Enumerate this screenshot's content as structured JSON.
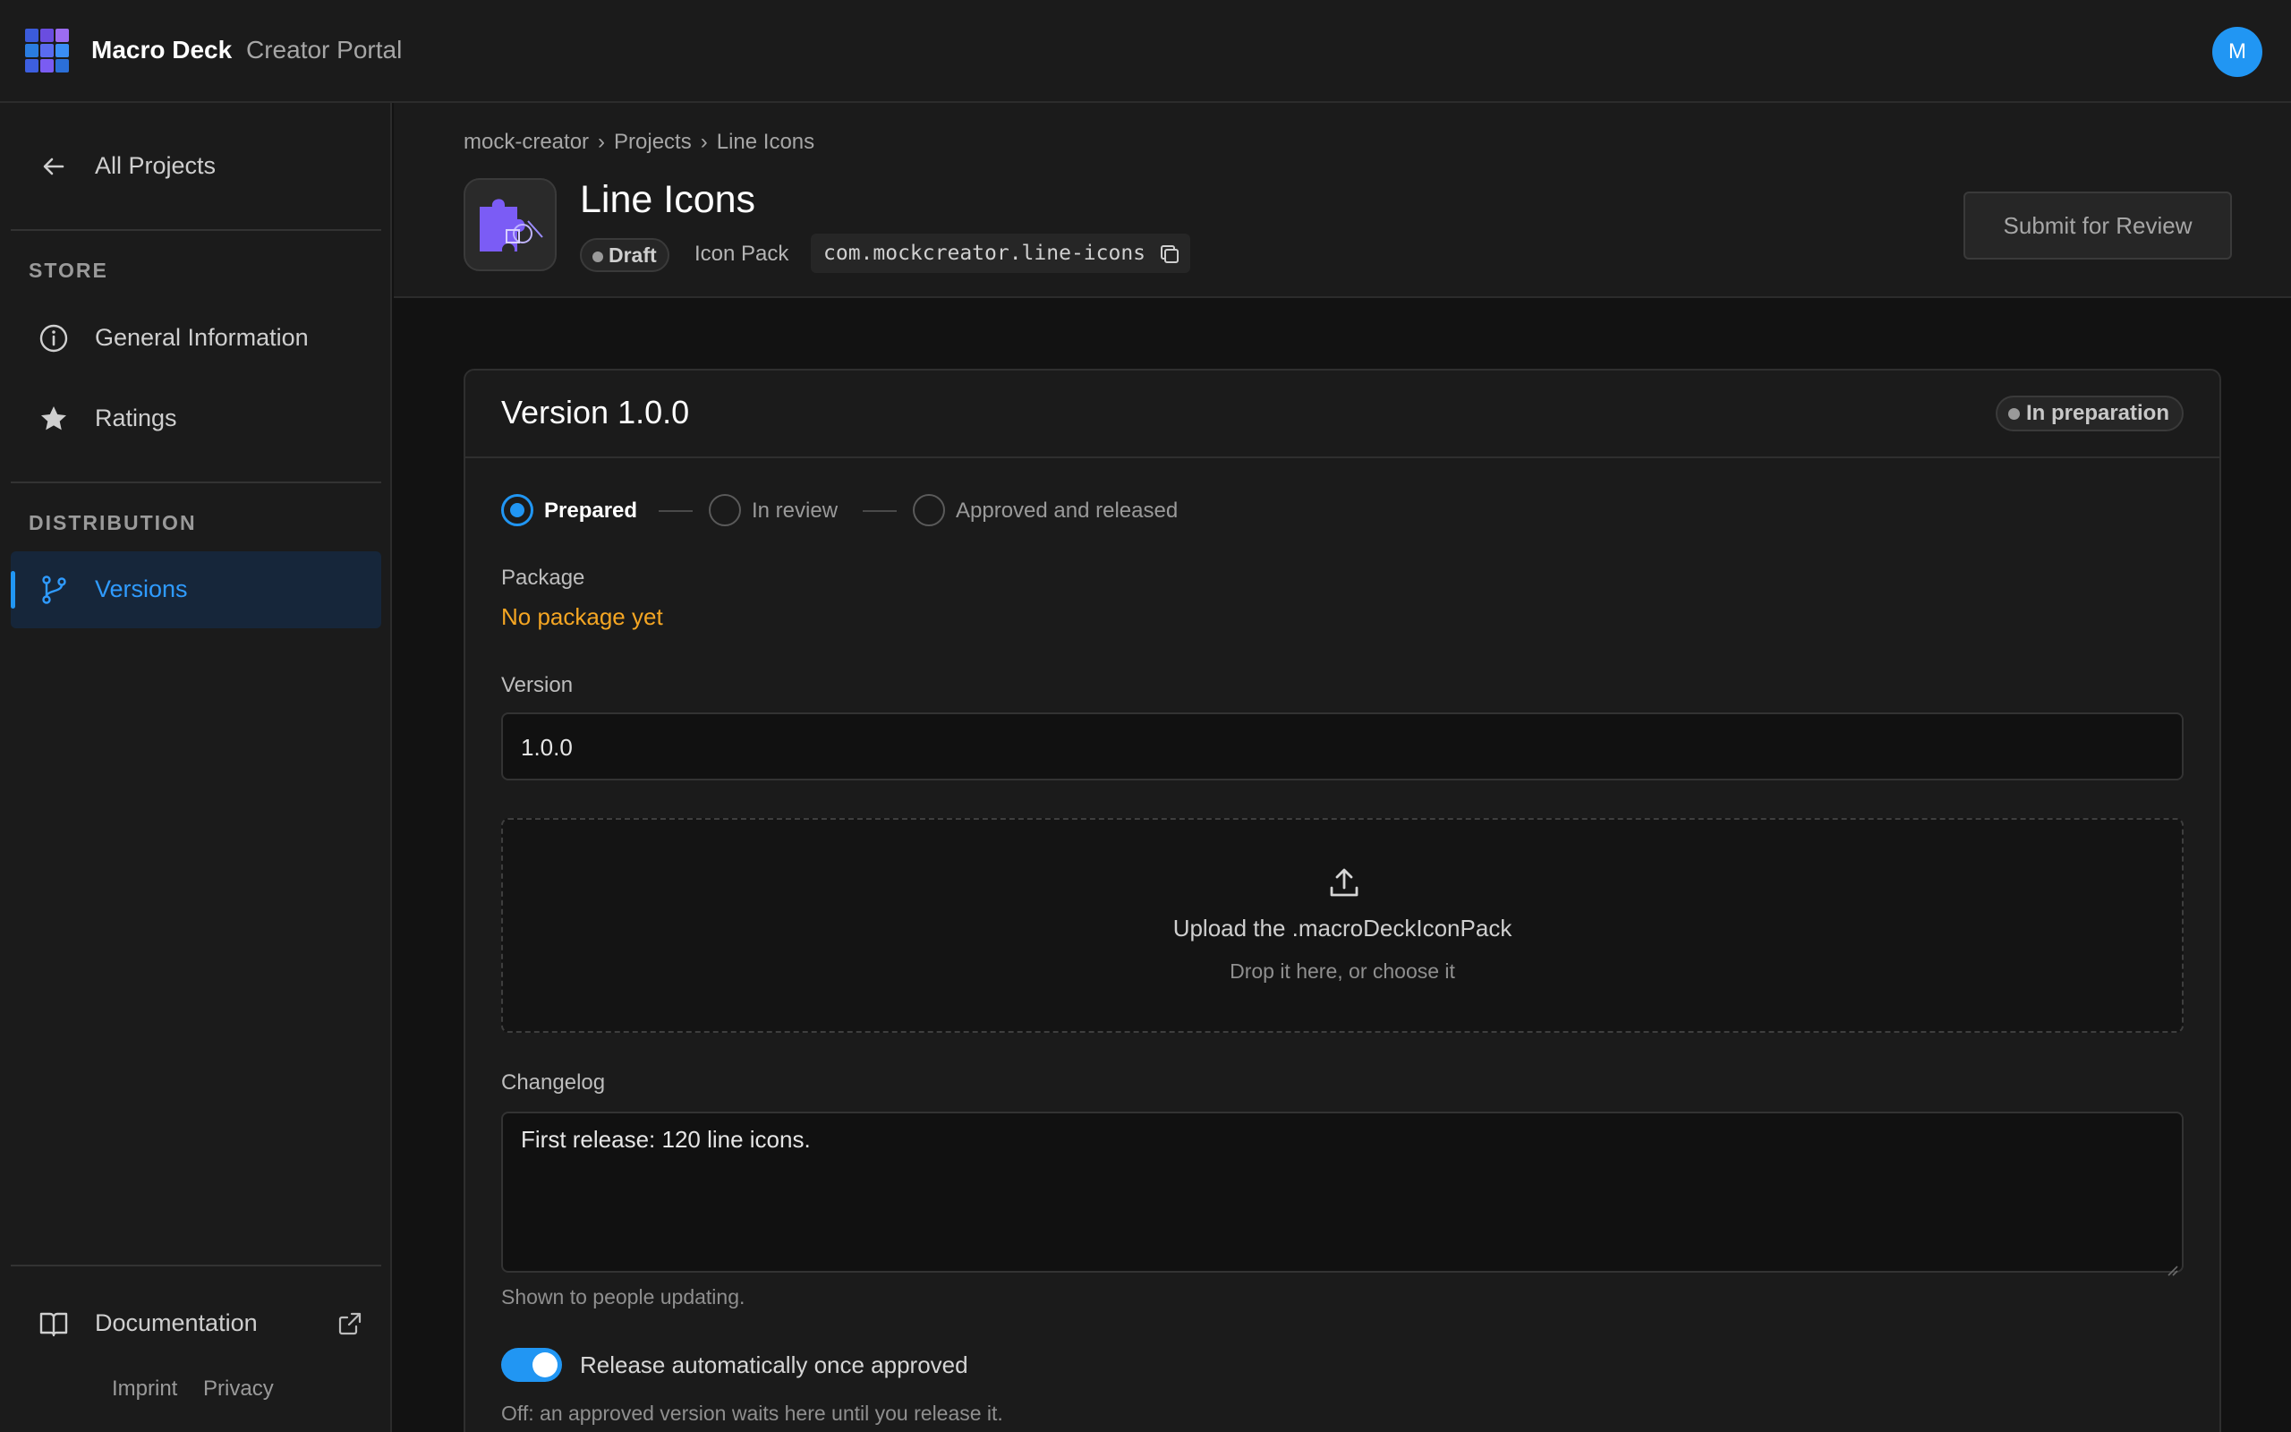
{
  "app": {
    "brand": "Macro Deck",
    "subtitle": "Creator Portal",
    "avatar_initial": "M"
  },
  "sidebar": {
    "back_label": "All Projects",
    "store_heading": "STORE",
    "store_items": [
      {
        "label": "General Information",
        "icon": "info-icon"
      },
      {
        "label": "Ratings",
        "icon": "star-icon"
      }
    ],
    "distribution_heading": "DISTRIBUTION",
    "distribution_items": [
      {
        "label": "Versions",
        "icon": "branch-icon",
        "active": true
      }
    ],
    "documentation_label": "Documentation",
    "footer_links": [
      "Imprint",
      "Privacy"
    ]
  },
  "breadcrumb": [
    "mock-creator",
    "Projects",
    "Line Icons"
  ],
  "project": {
    "title": "Line Icons",
    "status": "Draft",
    "kind": "Icon Pack",
    "package_id": "com.mockcreator.line-icons"
  },
  "actions": {
    "submit_label": "Submit for Review"
  },
  "version_card": {
    "title": "Version 1.0.0",
    "status": "In preparation",
    "steps": [
      {
        "label": "Prepared",
        "current": true
      },
      {
        "label": "In review",
        "current": false
      },
      {
        "label": "Approved and released",
        "current": false
      }
    ],
    "package_label": "Package",
    "package_status": "No package yet",
    "version_label": "Version",
    "version_value": "1.0.0",
    "upload_title": "Upload the .macroDeckIconPack",
    "upload_sub": "Drop it here, or choose it",
    "changelog_label": "Changelog",
    "changelog_value": "First release: 120 line icons.",
    "changelog_help": "Shown to people updating.",
    "auto_release_label": "Release automatically once approved",
    "auto_release_on": true,
    "auto_release_help": "Off: an approved version waits here until you release it."
  },
  "colors": {
    "accent": "#2196f3",
    "warning": "#f5a623",
    "background": "#121212",
    "surface": "#1b1b1b"
  }
}
